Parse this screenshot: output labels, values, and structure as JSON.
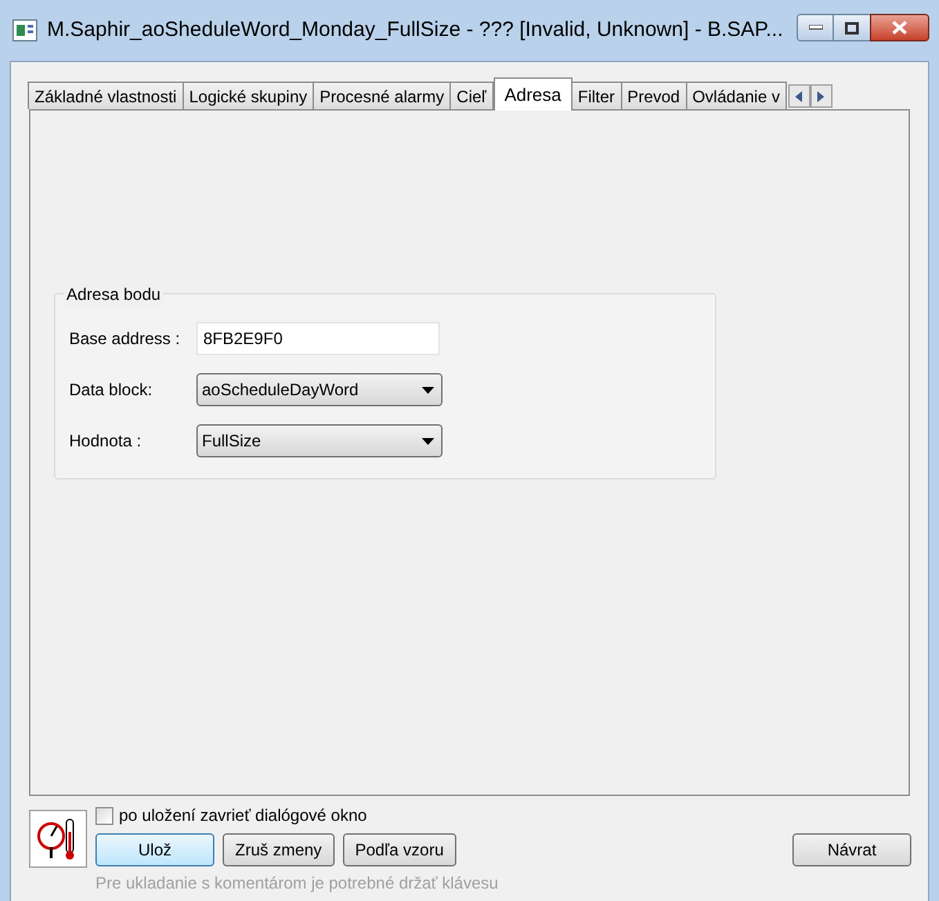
{
  "window": {
    "title": "M.Saphir_aoSheduleWord_Monday_FullSize - ??? [Invalid, Unknown] - B.SAP..."
  },
  "tabs": [
    {
      "label": "Základné vlastnosti",
      "selected": false
    },
    {
      "label": "Logické skupiny",
      "selected": false
    },
    {
      "label": "Procesné alarmy",
      "selected": false
    },
    {
      "label": "Cieľ",
      "selected": false
    },
    {
      "label": "Adresa",
      "selected": true
    },
    {
      "label": "Filter",
      "selected": false
    },
    {
      "label": "Prevod",
      "selected": false
    },
    {
      "label": "Ovládanie v",
      "selected": false
    }
  ],
  "group": {
    "title": "Adresa bodu",
    "fields": [
      {
        "kind": "text",
        "label": "Base address :",
        "value": "8FB2E9F0"
      },
      {
        "kind": "dropdown",
        "label": "Data block:",
        "value": "aoScheduleDayWord"
      },
      {
        "kind": "dropdown",
        "label": "Hodnota :",
        "value": "FullSize"
      }
    ]
  },
  "close_after_save": {
    "label": "po uložení zavrieť dialógové okno",
    "checked": false
  },
  "buttons": [
    {
      "label": "Ulož",
      "selected": true
    },
    {
      "label": "Zruš zmeny",
      "selected": false
    },
    {
      "label": "Podľa vzoru",
      "selected": false
    }
  ],
  "return_button": "Návrat",
  "hint": "Pre ukladanie s komentárom je potrebné držať klávesu"
}
